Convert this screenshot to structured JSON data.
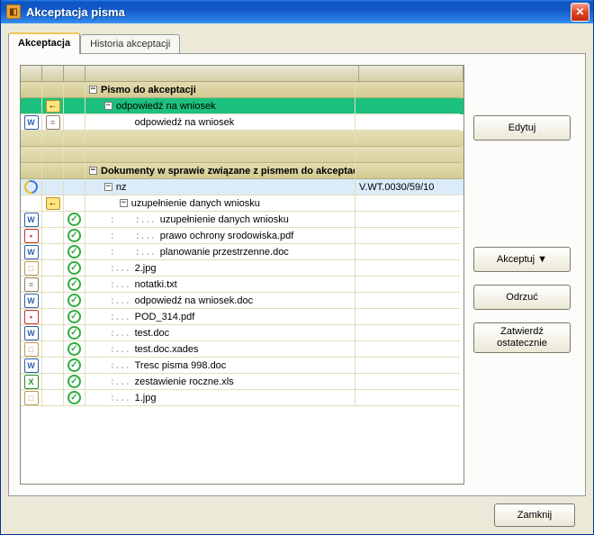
{
  "window": {
    "title": "Akceptacja pisma"
  },
  "tabs": {
    "active": "Akceptacja",
    "second": "Historia akceptacji"
  },
  "tree": {
    "section1": {
      "label": "Pismo do akceptacji"
    },
    "s1_item1": {
      "label": "odpowiedź na wniosek"
    },
    "s1_item2": {
      "label": "odpowiedź na wniosek"
    },
    "section2": {
      "label": "Dokumenty w sprawie związane z pismem do akceptacji"
    },
    "s2_item1": {
      "label": "nz",
      "ref": "V.WT.0030/59/10"
    },
    "s2_item2": {
      "label": "uzupełnienie danych wniosku"
    },
    "s2_item3": {
      "label": "uzupełnienie danych wniosku"
    },
    "s2_item4": {
      "label": "prawo ochrony srodowiska.pdf"
    },
    "s2_item5": {
      "label": "planowanie przestrzenne.doc"
    },
    "s2_item6": {
      "label": "2.jpg"
    },
    "s2_item7": {
      "label": "notatki.txt"
    },
    "s2_item8": {
      "label": "odpowiedź na wniosek.doc"
    },
    "s2_item9": {
      "label": "POD_314.pdf"
    },
    "s2_item10": {
      "label": "test.doc"
    },
    "s2_item11": {
      "label": "test.doc.xades"
    },
    "s2_item12": {
      "label": "Tresc pisma 998.doc"
    },
    "s2_item13": {
      "label": "zestawienie roczne.xls"
    },
    "s2_item14": {
      "label": "1.jpg"
    }
  },
  "buttons": {
    "edit": "Edytuj",
    "accept": "Akceptuj  ▼",
    "reject": "Odrzuć",
    "final1": "Zatwierdź",
    "final2": "ostatecznie",
    "close": "Zamknij"
  }
}
